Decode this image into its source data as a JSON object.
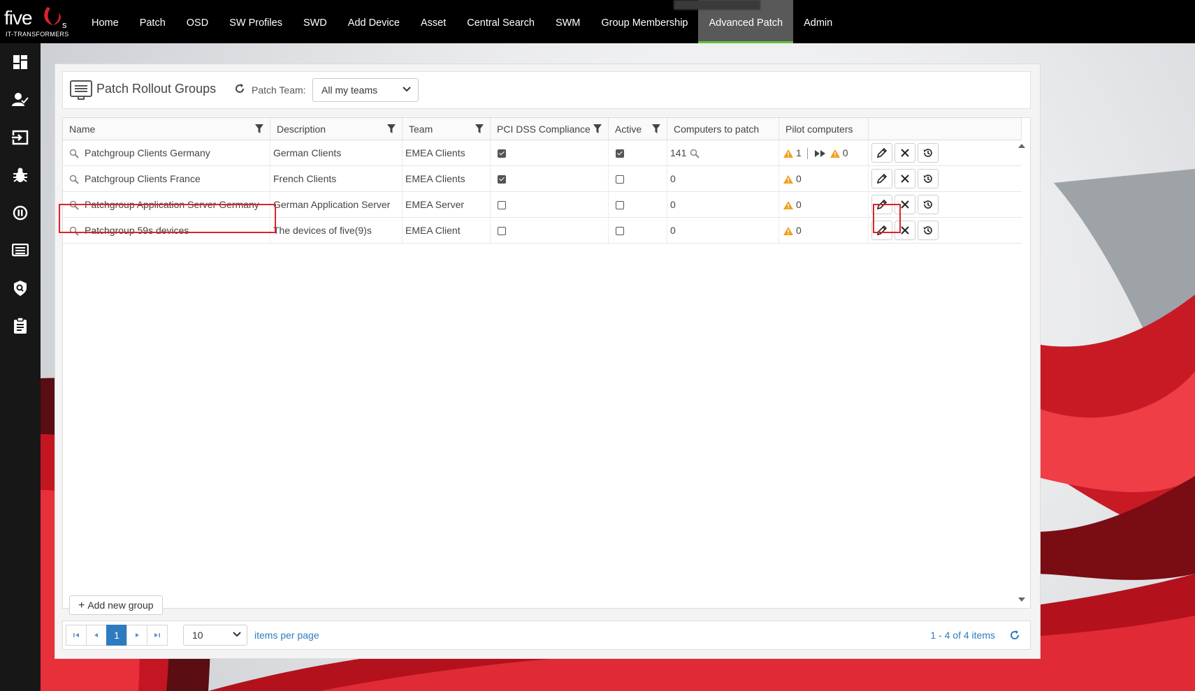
{
  "brand": {
    "name": "five",
    "suffix": "s",
    "tagline": "IT-TRANSFORMERS"
  },
  "nav": [
    {
      "label": "Home"
    },
    {
      "label": "Patch"
    },
    {
      "label": "OSD"
    },
    {
      "label": "SW Profiles"
    },
    {
      "label": "SWD"
    },
    {
      "label": "Add Device"
    },
    {
      "label": "Asset"
    },
    {
      "label": "Central Search"
    },
    {
      "label": "SWM"
    },
    {
      "label": "Group Membership"
    },
    {
      "label": "Advanced Patch",
      "active": true
    },
    {
      "label": "Admin"
    }
  ],
  "sidebar": [
    {
      "icon": "dashboard-icon"
    },
    {
      "icon": "user-check-icon"
    },
    {
      "icon": "login-arrow-icon"
    },
    {
      "icon": "bug-icon"
    },
    {
      "icon": "pause-circle-icon"
    },
    {
      "icon": "list-window-icon"
    },
    {
      "icon": "shield-search-icon"
    },
    {
      "icon": "clipboard-icon"
    }
  ],
  "panel": {
    "title": "Patch Rollout Groups",
    "team_label": "Patch Team:",
    "team_value": "All my teams"
  },
  "grid": {
    "columns": [
      {
        "label": "Name",
        "filter": true
      },
      {
        "label": "Description",
        "filter": true
      },
      {
        "label": "Team",
        "filter": true
      },
      {
        "label": "PCI DSS Compliance",
        "filter": true
      },
      {
        "label": "Active",
        "filter": true
      },
      {
        "label": "Computers to patch",
        "filter": false
      },
      {
        "label": "Pilot computers",
        "filter": false
      },
      {
        "label": "",
        "filter": false
      }
    ],
    "rows": [
      {
        "name": "Patchgroup Clients Germany",
        "description": "German Clients",
        "team": "EMEA Clients",
        "pci": true,
        "active": true,
        "computers": "141",
        "computers_search": true,
        "pilot": "1",
        "pilot_next": "0"
      },
      {
        "name": "Patchgroup Clients France",
        "description": "French Clients",
        "team": "EMEA Clients",
        "pci": true,
        "active": false,
        "computers": "0",
        "computers_search": false,
        "pilot": "0",
        "pilot_next": null
      },
      {
        "name": "Patchgroup Application Server Germany",
        "description": "German Application Server",
        "team": "EMEA Server",
        "pci": false,
        "active": false,
        "computers": "0",
        "computers_search": false,
        "pilot": "0",
        "pilot_next": null
      },
      {
        "name": "Patchgroup 59s devices",
        "description": "The devices of five(9)s",
        "team": "EMEA Client",
        "pci": false,
        "active": false,
        "computers": "0",
        "computers_search": false,
        "pilot": "0",
        "pilot_next": null
      }
    ],
    "add_label": "Add new group"
  },
  "pager": {
    "current_page": "1",
    "page_size": "10",
    "items_per_page_label": "items per page",
    "info": "1 - 4 of 4 items"
  },
  "colors": {
    "accent": "#2f7bbf",
    "nav_active_underline": "#5fbf3a",
    "highlight": "#d9232e",
    "warning": "#f0a020"
  }
}
